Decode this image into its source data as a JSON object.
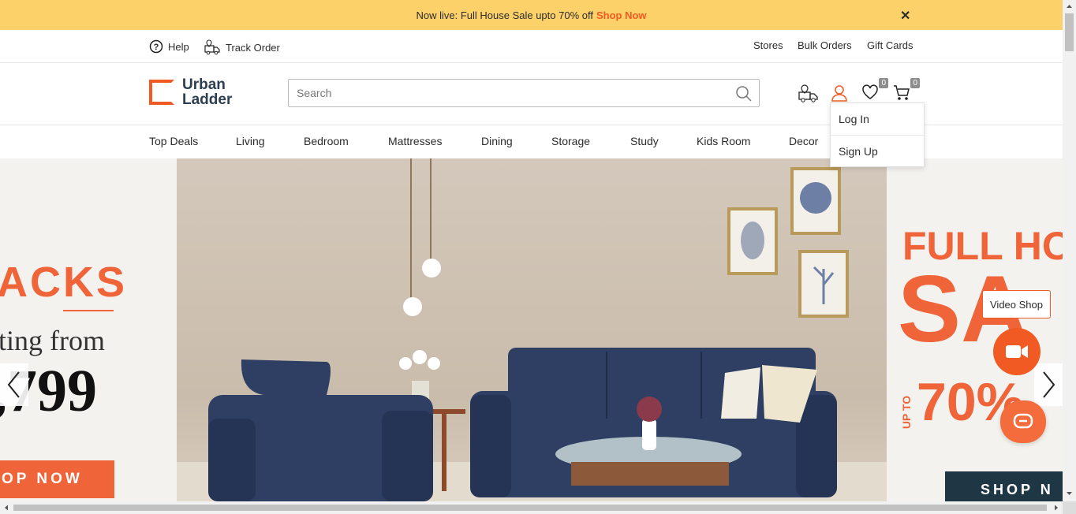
{
  "announcement": {
    "text": "Now live: Full House Sale upto 70% off",
    "link": "Shop Now",
    "close": "✕"
  },
  "utility": {
    "help": "Help",
    "track_order": "Track Order",
    "stores": "Stores",
    "bulk_orders": "Bulk Orders",
    "gift_cards": "Gift Cards"
  },
  "header": {
    "logo_line1": "Urban",
    "logo_line2": "Ladder",
    "search_placeholder": "Search",
    "wishlist_count": "0",
    "cart_count": "0"
  },
  "nav": [
    "Top Deals",
    "Living",
    "Bedroom",
    "Mattresses",
    "Dining",
    "Storage",
    "Study",
    "Kids Room",
    "Decor"
  ],
  "account_menu": {
    "login": "Log In",
    "signup": "Sign Up"
  },
  "hero": {
    "left_banner": {
      "line1": "ACKS",
      "line2": "ting from",
      "price": ",799",
      "cta": "OP NOW"
    },
    "right_banner": {
      "line1": "FULL HO",
      "line2": "SA",
      "upto": "UP TO",
      "pct": "70%",
      "cta": "SHOP N"
    }
  },
  "video_shop_label": "Video Shop",
  "colors": {
    "accent": "#f15a22",
    "announce_bg": "#fdd169",
    "sofa": "#2e3f63"
  }
}
